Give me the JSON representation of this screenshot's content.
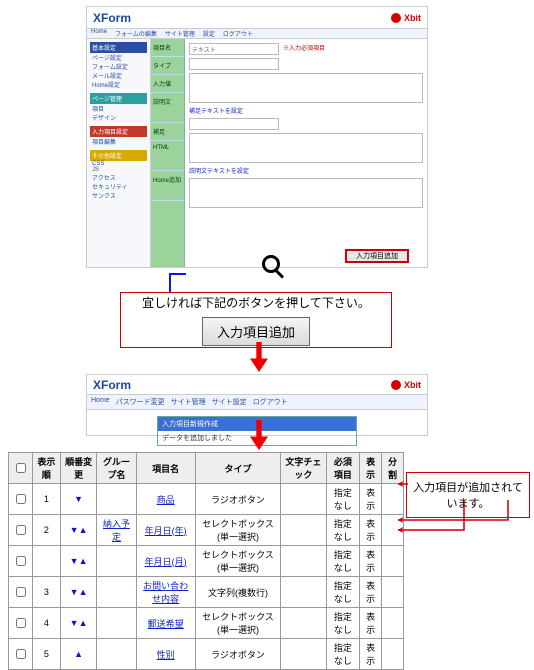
{
  "brand": {
    "xform": "XForm",
    "xbit": "Xbit"
  },
  "top": {
    "tabs": [
      "Home",
      "フォームの編集",
      "サイト管理",
      "設定",
      "ログアウト"
    ],
    "side_groups": [
      {
        "style": "blue",
        "head": "基本設定",
        "items": [
          "ページ設定",
          "フォーム設定",
          "メール設定",
          "Home設定"
        ]
      },
      {
        "style": "cy",
        "head": "ページ管理",
        "items": [
          "項目",
          "デザイン"
        ]
      },
      {
        "style": "red",
        "head": "入力項目設定",
        "items": [
          "項目編集"
        ]
      },
      {
        "style": "yel",
        "head": "その他設定",
        "items": [
          "CSS",
          "JS",
          "アクセス",
          "セキュリティ",
          "サンクス"
        ]
      }
    ],
    "green_labels": [
      "項目名",
      "タイプ",
      "入力値",
      "説明文",
      "補足",
      "HTML",
      "Home追加"
    ],
    "placeholder": "テキスト",
    "note_red": "※入力必須項目",
    "link_notes": [
      "補足テキストを設定",
      "説明文テキストを設定"
    ],
    "action_button": "入力項目追加"
  },
  "callout": {
    "text": "宜しければ下記のボタンを押して下さい。",
    "button": "入力項目追加"
  },
  "mid": {
    "tabs": [
      "Home",
      "パスワード変更",
      "サイト管理",
      "サイト設定",
      "ログアウト"
    ],
    "bar_title": "入力項目新規作成",
    "bar_msg": "データを追加しました"
  },
  "table": {
    "headers": [
      "",
      "表示順",
      "順番変更",
      "グループ名",
      "項目名",
      "タイプ",
      "文字チェック",
      "必須項目",
      "表示",
      "分割"
    ],
    "rows": [
      {
        "order": "1",
        "group": "",
        "name": "商品",
        "type": "ラジオボタン",
        "req": "指定なし",
        "show": "表示"
      },
      {
        "order": "2",
        "group": "納入予定",
        "name": "年月日(年)",
        "type": "セレクトボックス(単一選択)",
        "req": "指定なし",
        "show": "表示"
      },
      {
        "order": "",
        "group": "",
        "name": "年月日(月)",
        "type": "セレクトボックス(単一選択)",
        "req": "指定なし",
        "show": "表示"
      },
      {
        "order": "3",
        "group": "",
        "name": "お問い合わせ内容",
        "type": "文字列(複数行)",
        "req": "指定なし",
        "show": "表示"
      },
      {
        "order": "4",
        "group": "",
        "name": "郵送希望",
        "type": "セレクトボックス(単一選択)",
        "req": "指定なし",
        "show": "表示"
      },
      {
        "order": "5",
        "group": "",
        "name": "性別",
        "type": "ラジオボタン",
        "req": "指定なし",
        "show": "表示"
      }
    ]
  },
  "balloon": "入力項目が追加されています。"
}
